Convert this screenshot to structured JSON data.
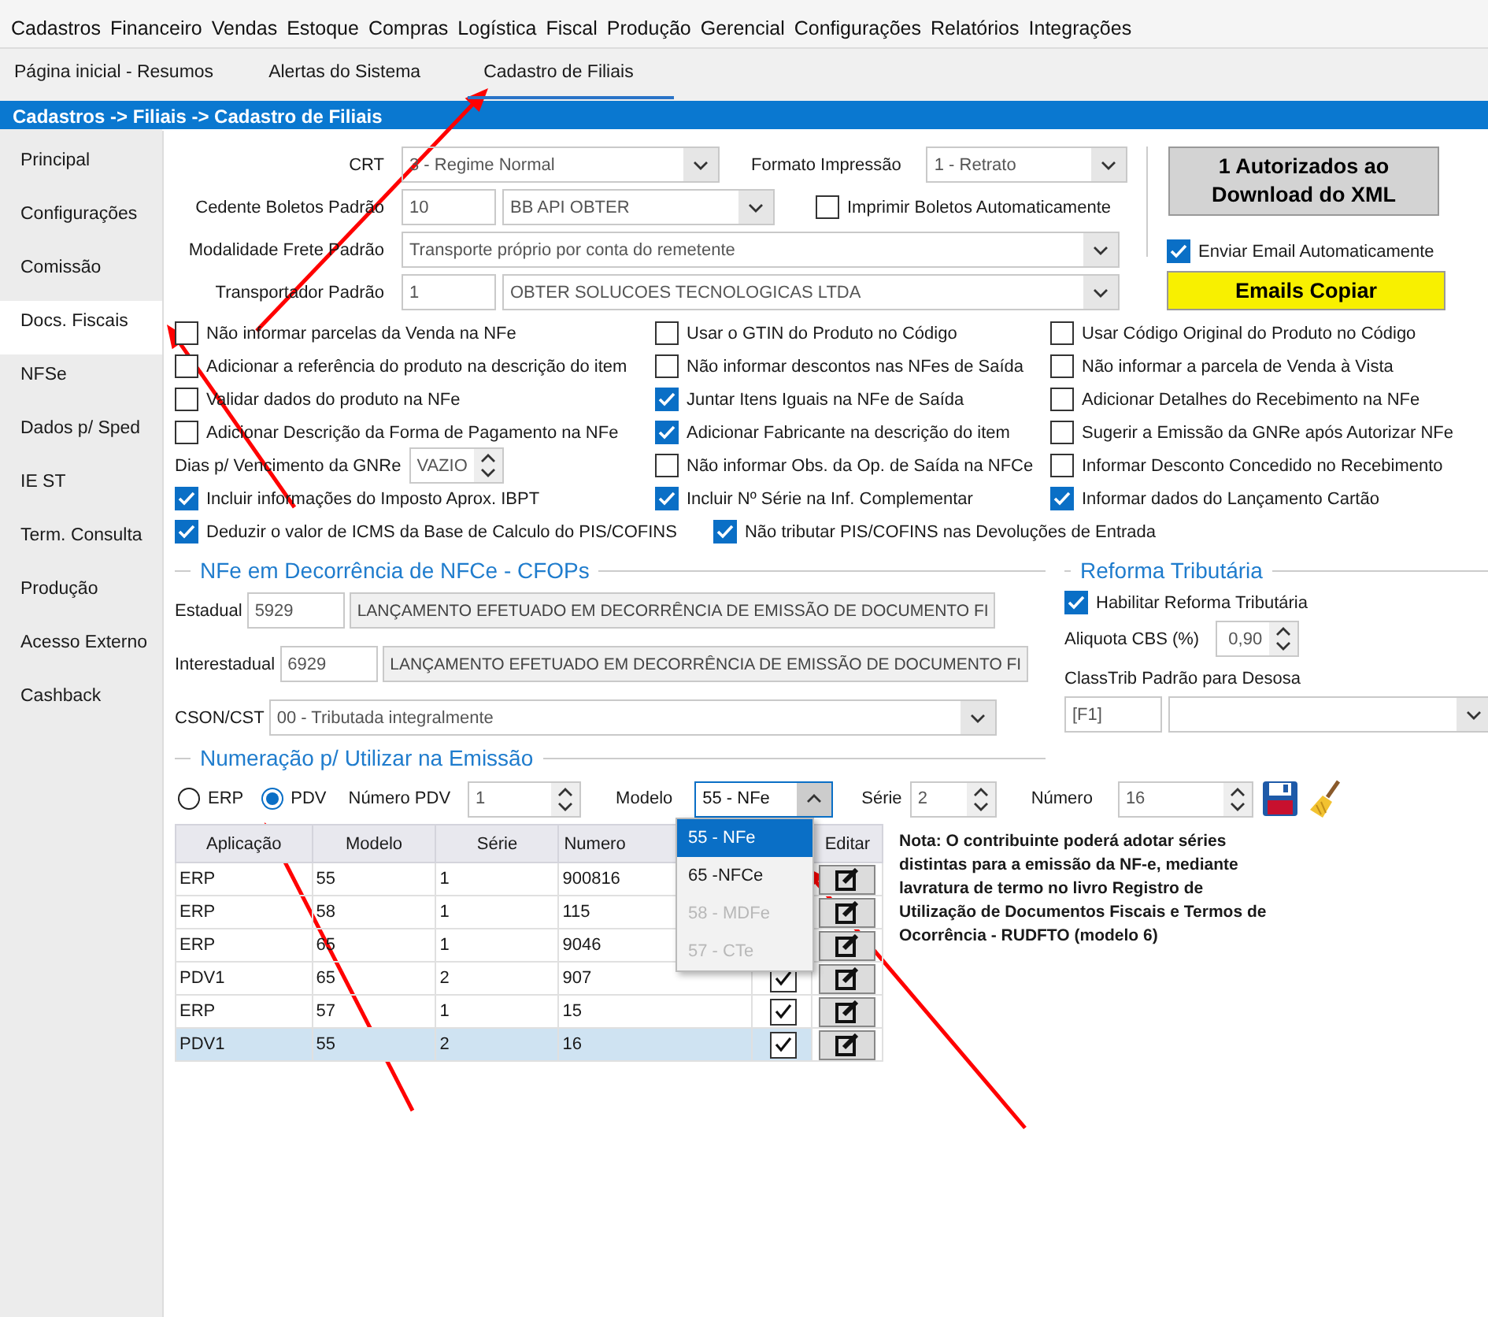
{
  "menu": [
    "Cadastros",
    "Financeiro",
    "Vendas",
    "Estoque",
    "Compras",
    "Logística",
    "Fiscal",
    "Produção",
    "Gerencial",
    "Configurações",
    "Relatórios",
    "Integrações"
  ],
  "tabs": [
    {
      "label": "Página inicial - Resumos",
      "selected": false
    },
    {
      "label": "Alertas do Sistema",
      "selected": false
    },
    {
      "label": "Cadastro de Filiais",
      "selected": true
    }
  ],
  "breadcrumb": "Cadastros -> Filiais -> Cadastro de Filiais",
  "sidebar": {
    "items": [
      {
        "label": "Principal",
        "selected": false
      },
      {
        "label": "Configurações",
        "selected": false
      },
      {
        "label": "Comissão",
        "selected": false
      },
      {
        "label": "Docs. Fiscais",
        "selected": true
      },
      {
        "label": "NFSe",
        "selected": false
      },
      {
        "label": "Dados p/ Sped",
        "selected": false
      },
      {
        "label": "IE ST",
        "selected": false
      },
      {
        "label": "Term. Consulta",
        "selected": false
      },
      {
        "label": "Produção",
        "selected": false
      },
      {
        "label": "Acesso Externo",
        "selected": false
      },
      {
        "label": "Cashback",
        "selected": false
      }
    ]
  },
  "form": {
    "crt": {
      "label": "CRT",
      "value": "3 - Regime Normal"
    },
    "formato_impressao": {
      "label": "Formato Impressão",
      "value": "1 - Retrato"
    },
    "cedente_boletos": {
      "label": "Cedente Boletos Padrão",
      "code": "10",
      "value": "BB API OBTER"
    },
    "imprimir_boletos": {
      "label": "Imprimir Boletos Automaticamente",
      "checked": false
    },
    "modalidade_frete": {
      "label": "Modalidade Frete Padrão",
      "value": "Transporte próprio por conta do remetente"
    },
    "transportador": {
      "label": "Transportador Padrão",
      "code": "1",
      "value": "OBTER SOLUCOES TECNOLOGICAS LTDA"
    }
  },
  "right_panel": {
    "autorizados_button": "1  Autorizados ao Download do XML",
    "enviar_email": {
      "label": "Enviar Email Automaticamente",
      "checked": true
    },
    "emails_button": "Emails Copiar"
  },
  "option_rows": [
    [
      {
        "kind": "checkbox",
        "label": "Não informar parcelas da Venda na NFe",
        "checked": false
      },
      {
        "kind": "checkbox",
        "label": "Usar o GTIN do Produto no Código",
        "checked": false
      },
      {
        "kind": "checkbox",
        "label": "Usar Código Original do Produto no Código",
        "checked": false
      }
    ],
    [
      {
        "kind": "checkbox",
        "label": "Adicionar a referência do produto na descrição do item",
        "checked": false
      },
      {
        "kind": "checkbox",
        "label": "Não informar descontos nas NFes de Saída",
        "checked": false
      },
      {
        "kind": "checkbox",
        "label": "Não informar a parcela de Venda à Vista",
        "checked": false
      }
    ],
    [
      {
        "kind": "checkbox",
        "label": "Validar dados do produto na NFe",
        "checked": false
      },
      {
        "kind": "checkbox",
        "label": "Juntar Itens Iguais na NFe de Saída",
        "checked": true
      },
      {
        "kind": "checkbox",
        "label": "Adicionar Detalhes do Recebimento na NFe",
        "checked": false
      }
    ],
    [
      {
        "kind": "checkbox",
        "label": "Adicionar Descrição da Forma de Pagamento na NFe",
        "checked": false
      },
      {
        "kind": "checkbox",
        "label": "Adicionar Fabricante na descrição do item",
        "checked": true
      },
      {
        "kind": "checkbox",
        "label": "Sugerir a Emissão da GNRe após Autorizar NFe",
        "checked": false
      }
    ],
    [
      {
        "kind": "spinner",
        "label": "Dias p/ Vencimento da GNRe",
        "value": "VAZIO"
      },
      {
        "kind": "checkbox",
        "label": "Não informar Obs. da Op. de Saída na NFCe",
        "checked": false
      },
      {
        "kind": "checkbox",
        "label": "Informar Desconto Concedido no Recebimento",
        "checked": false
      }
    ],
    [
      {
        "kind": "checkbox",
        "label": "Incluir informações do Imposto Aprox. IBPT",
        "checked": true
      },
      {
        "kind": "checkbox",
        "label": "Incluir Nº Série na Inf. Complementar",
        "checked": true
      },
      {
        "kind": "checkbox",
        "label": "Informar dados do Lançamento Cartão",
        "checked": true
      }
    ]
  ],
  "wide_options": [
    {
      "label": "Deduzir o valor de ICMS da Base de Calculo do PIS/COFINS",
      "checked": true
    },
    {
      "label": "Não tributar PIS/COFINS nas Devoluções de Entrada",
      "checked": true
    }
  ],
  "cfop_section": {
    "title": "NFe em Decorrência de NFCe - CFOPs",
    "estadual": {
      "label": "Estadual",
      "code": "5929",
      "value": "LANÇAMENTO EFETUADO EM DECORRÊNCIA DE EMISSÃO DE DOCUMENTO FI"
    },
    "interestadual": {
      "label": "Interestadual",
      "code": "6929",
      "value": "LANÇAMENTO EFETUADO EM DECORRÊNCIA DE EMISSÃO DE DOCUMENTO FI"
    },
    "cson": {
      "label": "CSON/CST",
      "value": "00 - Tributada integralmente"
    }
  },
  "reforma_section": {
    "title": "Reforma Tributária",
    "habilitar": {
      "label": "Habilitar Reforma Tributária",
      "checked": true
    },
    "aliquota": {
      "label": "Aliquota CBS (%)",
      "value": "0,90"
    },
    "classtrib_label": "ClassTrib Padrão para Desosa",
    "classtrib_code": "[F1]"
  },
  "numeracao_section": {
    "title": "Numeração p/ Utilizar na Emissão",
    "radios": [
      {
        "label": "ERP",
        "selected": false
      },
      {
        "label": "PDV",
        "selected": true
      }
    ],
    "numero_pdv": {
      "label": "Número PDV",
      "value": "1"
    },
    "modelo": {
      "label": "Modelo",
      "value": "55 - NFe",
      "expanded": true,
      "options": [
        {
          "label": "55 - NFe",
          "selected": true,
          "disabled": false
        },
        {
          "label": "65 -NFCe",
          "selected": false,
          "disabled": false
        },
        {
          "label": "58 - MDFe",
          "selected": false,
          "disabled": true
        },
        {
          "label": "57 - CTe",
          "selected": false,
          "disabled": true
        }
      ]
    },
    "serie": {
      "label": "Série",
      "value": "2"
    },
    "numero": {
      "label": "Número",
      "value": "16"
    },
    "table": {
      "columns": [
        "Aplicação",
        "Modelo",
        "Série",
        "Numero",
        "Editar"
      ],
      "rows": [
        {
          "cells": [
            "ERP",
            "55",
            "1",
            "900816"
          ],
          "selected": false
        },
        {
          "cells": [
            "ERP",
            "58",
            "1",
            "115"
          ],
          "selected": false
        },
        {
          "cells": [
            "ERP",
            "65",
            "1",
            "9046"
          ],
          "selected": false
        },
        {
          "cells": [
            "PDV1",
            "65",
            "2",
            "907"
          ],
          "checked": true,
          "selected": false
        },
        {
          "cells": [
            "ERP",
            "57",
            "1",
            "15"
          ],
          "checked": true,
          "selected": false
        },
        {
          "cells": [
            "PDV1",
            "55",
            "2",
            "16"
          ],
          "checked": true,
          "selected": true
        }
      ]
    },
    "nota": "Nota: O contribuinte poderá adotar séries distintas para a emissão da NF-e, mediante lavratura de termo no livro Registro de Utilização de Documentos Fiscais e Termos de Ocorrência - RUDFTO (modelo 6)"
  }
}
